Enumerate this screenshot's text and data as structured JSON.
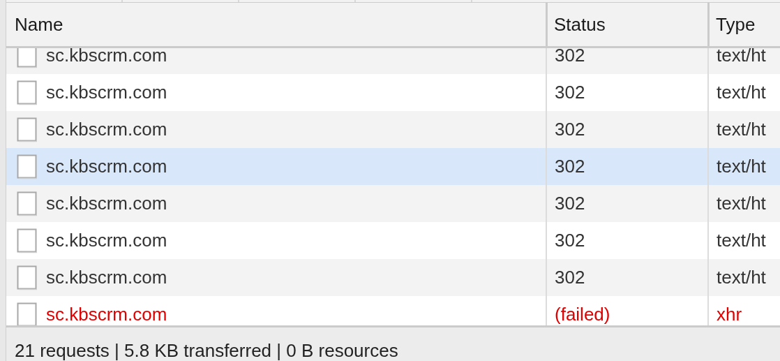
{
  "table": {
    "columns": [
      {
        "label": "Name"
      },
      {
        "label": "Status"
      },
      {
        "label": "Type"
      }
    ],
    "rows": [
      {
        "name": "sc.kbscrm.com",
        "status": "302",
        "type": "text/ht",
        "hovered": false,
        "failed": false
      },
      {
        "name": "sc.kbscrm.com",
        "status": "302",
        "type": "text/ht",
        "hovered": false,
        "failed": false
      },
      {
        "name": "sc.kbscrm.com",
        "status": "302",
        "type": "text/ht",
        "hovered": false,
        "failed": false
      },
      {
        "name": "sc.kbscrm.com",
        "status": "302",
        "type": "text/ht",
        "hovered": true,
        "failed": false
      },
      {
        "name": "sc.kbscrm.com",
        "status": "302",
        "type": "text/ht",
        "hovered": false,
        "failed": false
      },
      {
        "name": "sc.kbscrm.com",
        "status": "302",
        "type": "text/ht",
        "hovered": false,
        "failed": false
      },
      {
        "name": "sc.kbscrm.com",
        "status": "302",
        "type": "text/ht",
        "hovered": false,
        "failed": false
      },
      {
        "name": "sc.kbscrm.com",
        "status": "(failed)",
        "type": "xhr",
        "hovered": false,
        "failed": true
      }
    ]
  },
  "status_bar": {
    "text": "21 requests | 5.8 KB transferred | 0 B resources"
  }
}
